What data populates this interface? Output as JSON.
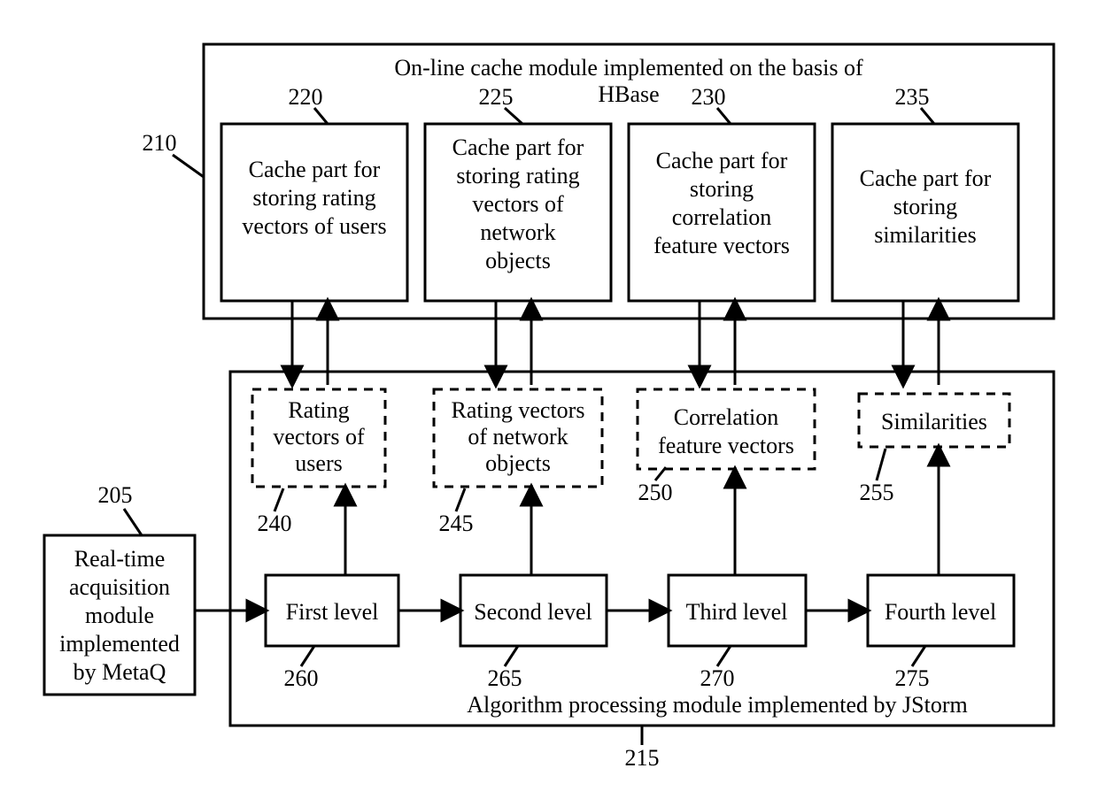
{
  "title_top1": "On-line cache module implemented on the basis of",
  "title_top2": "HBase",
  "title_bottom": "Algorithm processing module implemented by JStorm",
  "refs": {
    "r205": "205",
    "r210": "210",
    "r215": "215",
    "r220": "220",
    "r225": "225",
    "r230": "230",
    "r235": "235",
    "r240": "240",
    "r245": "245",
    "r250": "250",
    "r255": "255",
    "r260": "260",
    "r265": "265",
    "r270": "270",
    "r275": "275"
  },
  "cache": {
    "b220_l1": "Cache part for",
    "b220_l2": "storing rating",
    "b220_l3": "vectors of users",
    "b225_l1": "Cache part for",
    "b225_l2": "storing rating",
    "b225_l3": "vectors of",
    "b225_l4": "network",
    "b225_l5": "objects",
    "b230_l1": "Cache part for",
    "b230_l2": "storing",
    "b230_l3": "correlation",
    "b230_l4": "feature vectors",
    "b235_l1": "Cache part for",
    "b235_l2": "storing",
    "b235_l3": "similarities"
  },
  "dashed": {
    "d240_l1": "Rating",
    "d240_l2": "vectors of",
    "d240_l3": "users",
    "d245_l1": "Rating vectors",
    "d245_l2": "of network",
    "d245_l3": "objects",
    "d250_l1": "Correlation",
    "d250_l2": "feature vectors",
    "d255_l1": "Similarities"
  },
  "levels": {
    "l260": "First level",
    "l265": "Second level",
    "l270": "Third level",
    "l275": "Fourth level"
  },
  "acq": {
    "l1": "Real-time",
    "l2": "acquisition",
    "l3": "module",
    "l4": "implemented",
    "l5": "by MetaQ"
  }
}
